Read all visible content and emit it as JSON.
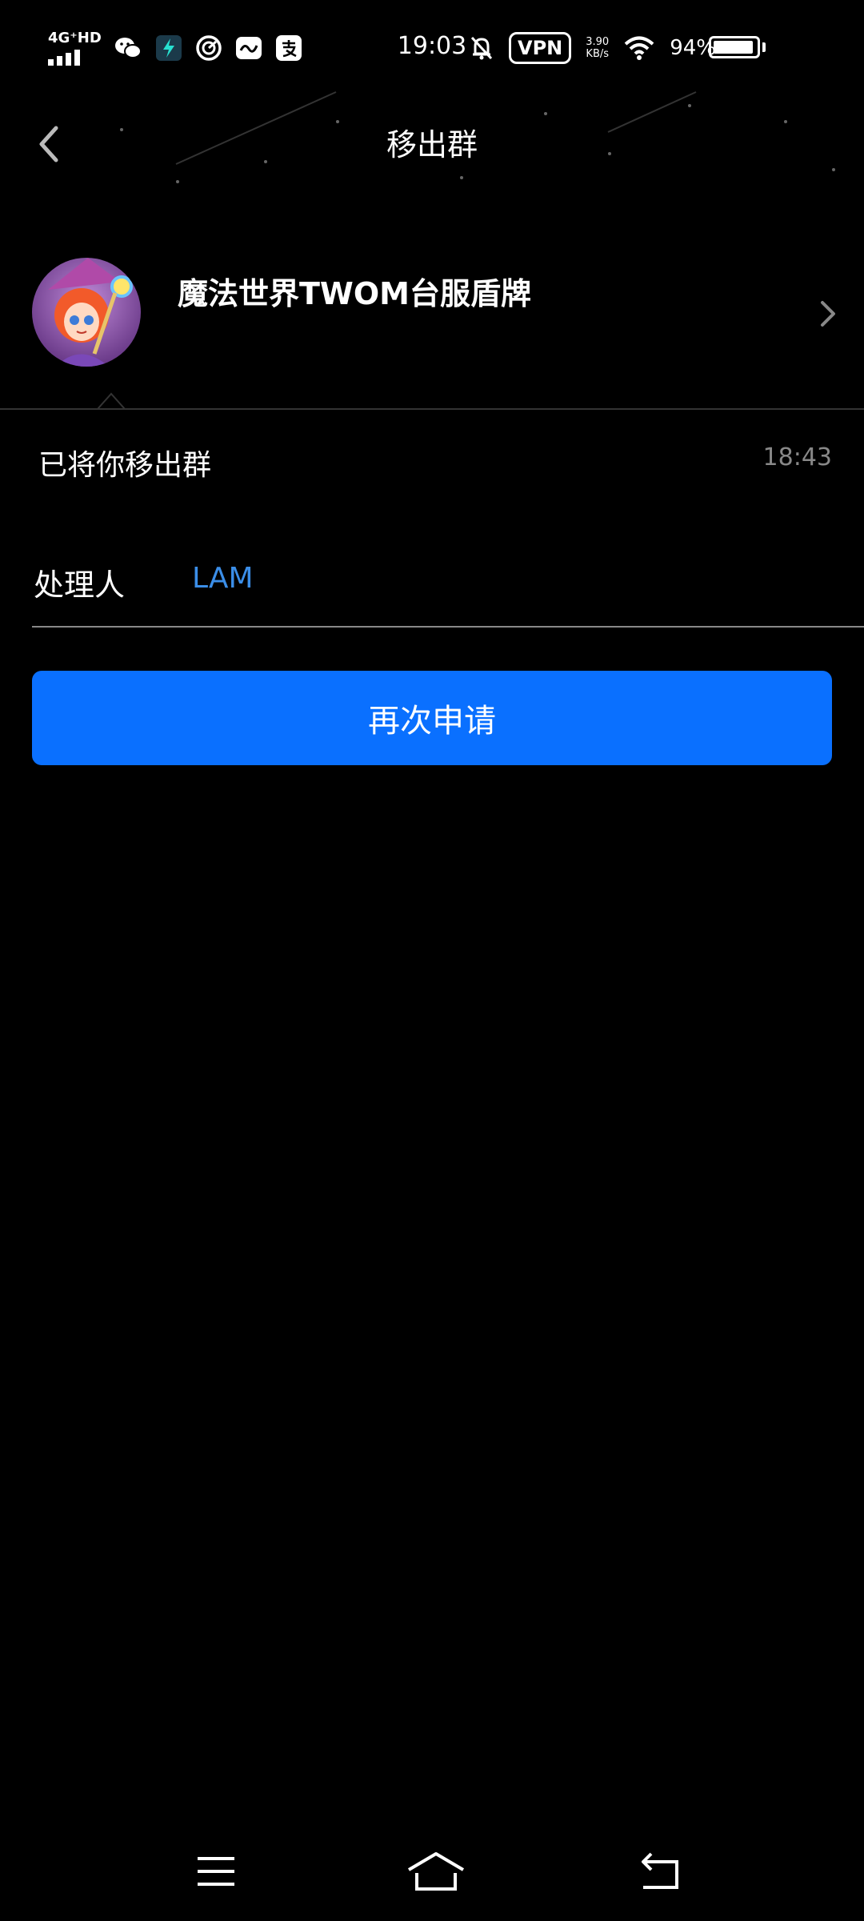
{
  "status_bar": {
    "network": "4G⁺HD",
    "time": "19:03",
    "vpn": "VPN",
    "speed_value": "3.90",
    "speed_unit": "KB/s",
    "battery": "94%",
    "app_icons": [
      "wechat-icon",
      "app-bolt-icon",
      "speed-gauge-icon",
      "chat-app-icon",
      "alipay-icon"
    ]
  },
  "nav": {
    "title": "移出群"
  },
  "group": {
    "name": "魔法世界TWOM台服盾牌"
  },
  "notice": {
    "message": "已将你移出群",
    "time": "18:43"
  },
  "handler": {
    "label": "处理人",
    "name": "LAM"
  },
  "actions": {
    "reapply_label": "再次申请"
  },
  "colors": {
    "accent": "#0a70ff",
    "link": "#3b8ee8",
    "background": "#000000"
  }
}
